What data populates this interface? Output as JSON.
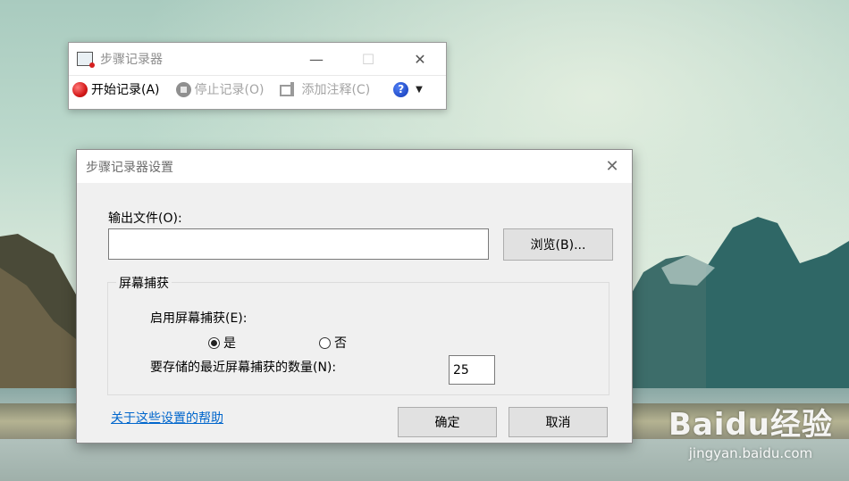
{
  "desktop": {
    "watermark_logo": "Baidu经验",
    "watermark_url": "jingyan.baidu.com"
  },
  "recorder": {
    "title": "步骤记录器",
    "minimize_icon": "—",
    "maximize_icon": "☐",
    "close_icon": "✕",
    "toolbar": {
      "start": "开始记录(A)",
      "stop": "停止记录(O)",
      "comment": "添加注释(C)",
      "help_icon": "?",
      "dropdown_icon": "▼"
    }
  },
  "dialog": {
    "title": "步骤记录器设置",
    "close_icon": "✕",
    "output_label": "输出文件(O):",
    "output_value": "",
    "browse_button": "浏览(B)...",
    "group_title": "屏幕捕获",
    "enable_label": "启用屏幕捕获(E):",
    "radio_yes": "是",
    "radio_no": "否",
    "radio_selected": "是",
    "count_label": "要存储的最近屏幕捕获的数量(N):",
    "count_value": "25",
    "help_link": "关于这些设置的帮助",
    "ok_button": "确定",
    "cancel_button": "取消"
  }
}
